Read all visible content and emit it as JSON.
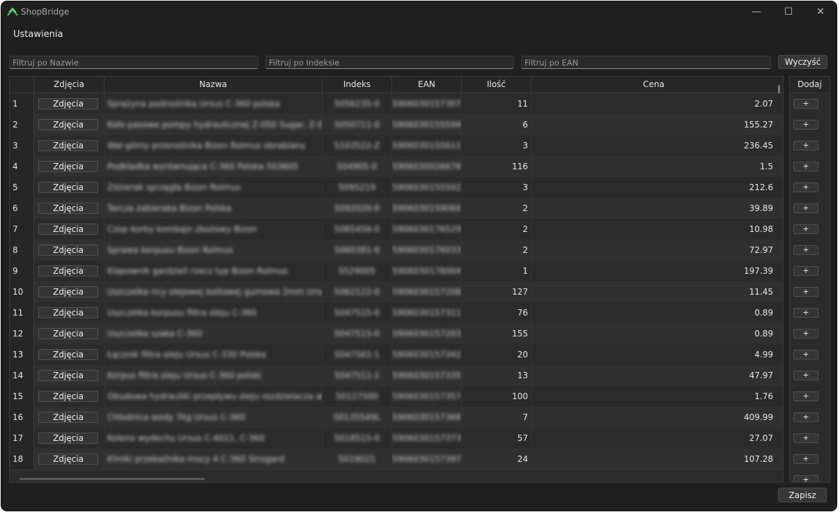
{
  "window": {
    "title": "ShopBridge",
    "controls": {
      "minimize": "—",
      "maximize": "☐",
      "close": "✕"
    }
  },
  "menu": {
    "settings": "Ustawienia"
  },
  "filters": {
    "name_placeholder": "Filtruj po Nazwie",
    "index_placeholder": "Filtruj po Indeksie",
    "ean_placeholder": "Filtruj po EAN",
    "clear_label": "Wyczyść"
  },
  "table": {
    "headers": {
      "photos": "Zdjęcia",
      "name": "Nazwa",
      "index": "Indeks",
      "ean": "EAN",
      "qty": "Ilość",
      "price": "Cena"
    },
    "photo_button_label": "Zdjęcia",
    "rows": [
      {
        "num": "1",
        "name": "Sprężyna podnośnika Ursus C-360 polska",
        "index": "5056235-0",
        "ean": "5906030157307",
        "qty": "11",
        "price": "2.07"
      },
      {
        "num": "2",
        "name": "Koło pasowe pompy hydraulicznej Z-050    Sugar, Z-050...",
        "index": "5050711-0",
        "ean": "5906030155594",
        "qty": "6",
        "price": "155.27"
      },
      {
        "num": "3",
        "name": "Wał górny przenośnika Bizon Rolmus        obrabiany",
        "index": "5103522-Z",
        "ean": "5906030155611",
        "qty": "3",
        "price": "236.45"
      },
      {
        "num": "4",
        "name": "Podkładka wyrównująca C-360 Polska      503605",
        "index": "504905-0",
        "ean": "5906030026676",
        "qty": "116",
        "price": "1.5"
      },
      {
        "num": "5",
        "name": "Ździerak sprzęgła Bizon Rolmus",
        "index": "5095219",
        "ean": "5906030155502",
        "qty": "3",
        "price": "212.6"
      },
      {
        "num": "6",
        "name": "Tarcza zabieraka Bizon Polska",
        "index": "5092020-0",
        "ean": "5906030159060",
        "qty": "2",
        "price": "39.89"
      },
      {
        "num": "7",
        "name": "Czop korby kombajn zbożowy Bizon",
        "index": "5065456-0",
        "ean": "5906030176529",
        "qty": "2",
        "price": "10.98"
      },
      {
        "num": "8",
        "name": "Sprawa korpusu Bizon Rolmus",
        "index": "5060381-0",
        "ean": "5906030176033",
        "qty": "2",
        "price": "72.97"
      },
      {
        "num": "9",
        "name": "Klapownik gardzieli rzecz typ Bizon Rolmus",
        "index": "5529005",
        "ean": "5906030176004",
        "qty": "1",
        "price": "197.39"
      },
      {
        "num": "10",
        "name": "Uszczelka ricy olejowej boltowej gumowa    2mm Ursus...",
        "index": "5062122-0",
        "ean": "5906030157208",
        "qty": "127",
        "price": "11.45"
      },
      {
        "num": "11",
        "name": "Uszczelka korpusu filtra oleju C-360",
        "index": "5047515-0",
        "ean": "5906030157311",
        "qty": "76",
        "price": "0.89"
      },
      {
        "num": "12",
        "name": "Uszczelka szaka C-360",
        "index": "5047515-0",
        "ean": "5906030157203",
        "qty": "155",
        "price": "0.89"
      },
      {
        "num": "13",
        "name": "Łącznik filtra oleju Ursus C-330 Polska",
        "index": "5047561-1",
        "ean": "5906030157342",
        "qty": "20",
        "price": "4.99"
      },
      {
        "num": "14",
        "name": "Korpus filtra oleju Ursus C-360 polski",
        "index": "5047511-1",
        "ean": "5906030157335",
        "qty": "13",
        "price": "47.97"
      },
      {
        "num": "15",
        "name": "Obudowa hydrauliki przepływu oleju        rozdzielacza wody",
        "index": "50127500",
        "ean": "5906030157357",
        "qty": "100",
        "price": "1.76"
      },
      {
        "num": "16",
        "name": "Chłodnica wody 7kg Ursus C-360",
        "index": "50135549L",
        "ean": "5906030157366",
        "qty": "7",
        "price": "409.99"
      },
      {
        "num": "17",
        "name": "Koleno wydechu Ursus C-4011, C-360",
        "index": "5018515-0",
        "ean": "5906030157373",
        "qty": "57",
        "price": "27.07"
      },
      {
        "num": "18",
        "name": "Kliniki przekaźnika mocy 4 C-360 Strogard",
        "index": "5019021",
        "ean": "5906030157397",
        "qty": "24",
        "price": "107.28"
      }
    ]
  },
  "dodaj": {
    "header": "Dodaj",
    "plus_label": "+"
  },
  "footer": {
    "save_label": "Zapisz"
  },
  "colors": {
    "window_bg": "#1f1f1f",
    "table_bg": "#2b2b2b",
    "row_alt_bg": "#303030",
    "logo_green": "#4fb35a"
  }
}
